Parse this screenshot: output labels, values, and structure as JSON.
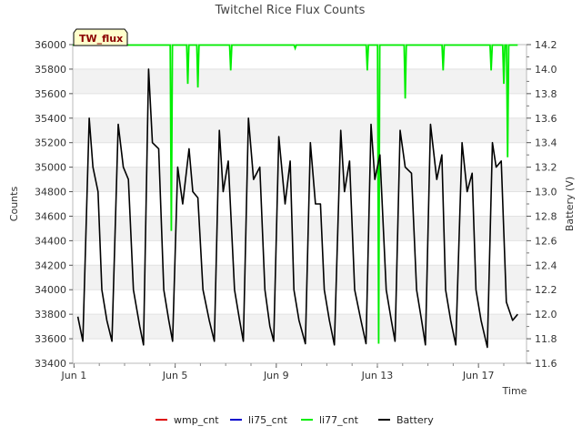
{
  "chart_data": {
    "type": "line",
    "title": "Twitchel Rice Flux Counts",
    "site_label": "TW_flux",
    "xlabel": "Time",
    "ylabel": "Counts",
    "y2label": "Battery (V)",
    "x_ticks": [
      {
        "day": 1,
        "label": "Jun 1"
      },
      {
        "day": 5,
        "label": "Jun 5"
      },
      {
        "day": 9,
        "label": "Jun 9"
      },
      {
        "day": 13,
        "label": "Jun 13"
      },
      {
        "day": 17,
        "label": "Jun 17"
      }
    ],
    "xlim_days": [
      0.95,
      18.9
    ],
    "ylim": [
      33400,
      36000
    ],
    "y_ticks": [
      33400,
      33600,
      33800,
      34000,
      34200,
      34400,
      34600,
      34800,
      35000,
      35200,
      35400,
      35600,
      35800,
      36000
    ],
    "y2lim": [
      11.6,
      14.2
    ],
    "y2_ticks": [
      "11.6",
      "11.8",
      "12.0",
      "12.2",
      "12.4",
      "12.6",
      "12.8",
      "13.0",
      "13.2",
      "13.4",
      "13.6",
      "13.8",
      "14.0",
      "14.2"
    ],
    "grid": "horizontal bands",
    "legend_position": "bottom",
    "series": [
      {
        "name": "wmp_cnt",
        "color": "#dd0000",
        "axis": "left",
        "values": []
      },
      {
        "name": "li75_cnt",
        "color": "#0000cc",
        "axis": "left",
        "values": []
      },
      {
        "name": "li77_cnt",
        "color": "#00ee00",
        "axis": "left",
        "baseline": 36000,
        "dips": [
          {
            "day": 4.85,
            "value": 34480
          },
          {
            "day": 5.5,
            "value": 35680
          },
          {
            "day": 5.9,
            "value": 35650
          },
          {
            "day": 7.2,
            "value": 35790
          },
          {
            "day": 9.75,
            "value": 35970
          },
          {
            "day": 12.6,
            "value": 35790
          },
          {
            "day": 13.05,
            "value": 33560
          },
          {
            "day": 14.1,
            "value": 35560
          },
          {
            "day": 15.6,
            "value": 35790
          },
          {
            "day": 17.5,
            "value": 35790
          },
          {
            "day": 18.0,
            "value": 35680
          },
          {
            "day": 18.15,
            "value": 35080
          }
        ]
      },
      {
        "name": "Battery",
        "color": "#000000",
        "axis": "right",
        "x_days": [
          1.15,
          1.35,
          1.6,
          1.75,
          1.95,
          2.1,
          2.3,
          2.5,
          2.75,
          2.95,
          3.15,
          3.35,
          3.6,
          3.75,
          3.95,
          4.1,
          4.35,
          4.55,
          4.75,
          4.9,
          5.1,
          5.3,
          5.55,
          5.7,
          5.9,
          6.1,
          6.35,
          6.55,
          6.75,
          6.9,
          7.1,
          7.35,
          7.55,
          7.7,
          7.9,
          8.1,
          8.35,
          8.55,
          8.75,
          8.9,
          9.1,
          9.35,
          9.55,
          9.7,
          9.9,
          10.15,
          10.35,
          10.55,
          10.75,
          10.9,
          11.1,
          11.3,
          11.55,
          11.7,
          11.9,
          12.1,
          12.35,
          12.55,
          12.75,
          12.9,
          13.1,
          13.35,
          13.55,
          13.7,
          13.9,
          14.1,
          14.35,
          14.55,
          14.75,
          14.9,
          15.1,
          15.35,
          15.55,
          15.7,
          15.9,
          16.1,
          16.35,
          16.55,
          16.75,
          16.9,
          17.1,
          17.35,
          17.55,
          17.7,
          17.9,
          18.1,
          18.35,
          18.55
        ],
        "values": [
          11.98,
          11.78,
          13.6,
          13.2,
          13.0,
          12.2,
          11.95,
          11.78,
          13.55,
          13.2,
          13.1,
          12.2,
          11.9,
          11.75,
          14.0,
          13.4,
          13.35,
          12.2,
          11.95,
          11.78,
          13.2,
          12.9,
          13.35,
          13.0,
          12.95,
          12.2,
          11.95,
          11.78,
          13.5,
          13.0,
          13.25,
          12.2,
          11.95,
          11.78,
          13.6,
          13.1,
          13.2,
          12.2,
          11.9,
          11.78,
          13.45,
          12.9,
          13.25,
          12.2,
          11.95,
          11.76,
          13.4,
          12.9,
          12.9,
          12.2,
          11.95,
          11.75,
          13.5,
          13.0,
          13.25,
          12.2,
          11.95,
          11.76,
          13.55,
          13.1,
          13.3,
          12.2,
          11.95,
          11.78,
          13.5,
          13.2,
          13.15,
          12.2,
          11.95,
          11.75,
          13.55,
          13.1,
          13.3,
          12.2,
          11.95,
          11.75,
          13.4,
          13.0,
          13.15,
          12.2,
          11.95,
          11.73,
          13.4,
          13.2,
          13.25,
          12.1,
          11.95,
          12.0
        ]
      }
    ]
  }
}
